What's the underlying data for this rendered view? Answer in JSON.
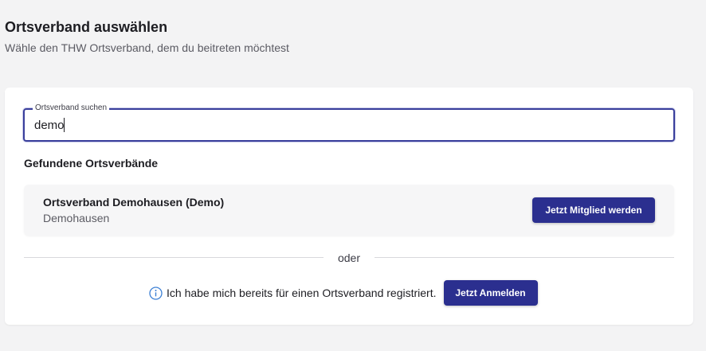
{
  "header": {
    "title": "Ortsverband auswählen",
    "subtitle": "Wähle den THW Ortsverband, dem du beitreten möchtest"
  },
  "search": {
    "label": "Ortsverband suchen",
    "value": "demo"
  },
  "results": {
    "heading": "Gefundene Ortsverbände",
    "items": [
      {
        "name": "Ortsverband Demohausen (Demo)",
        "city": "Demohausen",
        "button_label": "Jetzt Mitglied werden"
      }
    ]
  },
  "divider": {
    "text": "oder"
  },
  "login": {
    "icon": "info-icon",
    "text": "Ich habe mich bereits für einen Ortsverband registriert.",
    "button_label": "Jetzt Anmelden"
  },
  "colors": {
    "primary": "#2b2f8f",
    "background": "#f3f3f4",
    "info_icon": "#3b7fd4"
  }
}
